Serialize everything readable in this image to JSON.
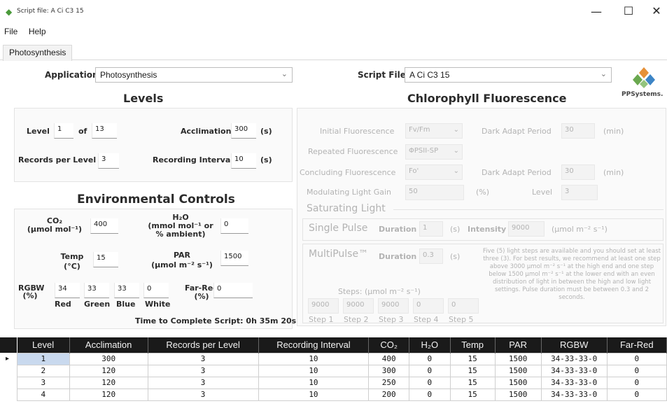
{
  "window": {
    "title": "Script file: A Ci C3 15",
    "minimize": "—",
    "maximize": "☐",
    "close": "✕"
  },
  "menu": {
    "file": "File",
    "help": "Help"
  },
  "tabs": {
    "active": "Photosynthesis"
  },
  "application": {
    "label": "Application",
    "value": "Photosynthesis"
  },
  "script_file": {
    "label": "Script File",
    "value": "A Ci C3 15"
  },
  "brand": {
    "logo_text": "PPSystems."
  },
  "levels": {
    "title": "Levels",
    "level_label": "Level",
    "level_value": "1",
    "of_label": "of",
    "of_value": "13",
    "acclimation_label": "Acclimation",
    "acclimation_value": "300",
    "acclimation_unit": "(s)",
    "records_label": "Records per Level",
    "records_value": "3",
    "interval_label": "Recording Interval",
    "interval_value": "10",
    "interval_unit": "(s)"
  },
  "chlorophyll": {
    "title": "Chlorophyll Fluorescence",
    "initial_label": "Initial Fluorescence",
    "initial_value": "Fv/Fm",
    "dark_adapt_label": "Dark Adapt Period",
    "dark_adapt_value_1": "30",
    "dark_adapt_unit": "(min)",
    "repeated_label": "Repeated Fluorescence",
    "repeated_value": "ΦPSII-SP",
    "concluding_label": "Concluding Fluorescence",
    "concluding_value": "Fo'",
    "dark_adapt_value_2": "30",
    "mod_gain_label": "Modulating Light Gain",
    "mod_gain_value": "50",
    "mod_gain_unit": "(%)",
    "level_label": "Level",
    "level_value": "3",
    "saturating_title": "Saturating Light",
    "single_pulse": "Single Pulse",
    "duration_label": "Duration",
    "single_duration": "1",
    "sec_unit": "(s)",
    "intensity_label": "Intensity",
    "intensity_value": "9000",
    "intensity_unit": "(µmol m⁻² s⁻¹)",
    "multipulse": "MultiPulse™",
    "multi_duration": "0.3",
    "multi_note": "Five (5) light steps are available and you should set at least three (3). For best results, we recommend at least one step above 3000 µmol m⁻² s⁻¹ at the high end and one step below 1500 µmol m⁻² s⁻¹ at the lower end with an even distribution of light in between the high and low light settings. Pulse duration must be between 0.3 and 2 seconds.",
    "steps_label": "Steps: (µmol m⁻² s⁻¹)",
    "step_values": [
      "9000",
      "9000",
      "9000",
      "0",
      "0"
    ],
    "step_names": [
      "Step 1",
      "Step 2",
      "Step 3",
      "Step 4",
      "Step 5"
    ]
  },
  "env": {
    "title": "Environmental Controls",
    "co2_label_1": "CO₂",
    "co2_label_2": "(µmol mol⁻¹)",
    "co2_value": "400",
    "h2o_label_1": "H₂O",
    "h2o_label_2": "(mmol mol⁻¹ or",
    "h2o_label_3": "% ambient)",
    "h2o_value": "0",
    "temp_label_1": "Temp",
    "temp_label_2": "(°C)",
    "temp_value": "15",
    "par_label_1": "PAR",
    "par_label_2": "(µmol m⁻² s⁻¹)",
    "par_value": "1500",
    "rgbw_label_1": "RGBW",
    "rgbw_label_2": "(%)",
    "red_value": "34",
    "green_value": "33",
    "blue_value": "33",
    "white_value": "0",
    "red_label": "Red",
    "green_label": "Green",
    "blue_label": "Blue",
    "white_label": "White",
    "farred_label_1": "Far-Red",
    "farred_label_2": "(%)",
    "farred_value": "0",
    "time_label": "Time to Complete Script: 0h 35m 20s"
  },
  "grid": {
    "headers": [
      "Level",
      "Acclimation",
      "Records per Level",
      "Recording Interval",
      "CO₂",
      "H₂O",
      "Temp",
      "PAR",
      "RGBW",
      "Far-Red"
    ],
    "rows": [
      [
        "1",
        "300",
        "3",
        "10",
        "400",
        "0",
        "15",
        "1500",
        "34-33-33-0",
        "0"
      ],
      [
        "2",
        "120",
        "3",
        "10",
        "300",
        "0",
        "15",
        "1500",
        "34-33-33-0",
        "0"
      ],
      [
        "3",
        "120",
        "3",
        "10",
        "250",
        "0",
        "15",
        "1500",
        "34-33-33-0",
        "0"
      ],
      [
        "4",
        "120",
        "3",
        "10",
        "200",
        "0",
        "15",
        "1500",
        "34-33-33-0",
        "0"
      ]
    ],
    "row_marker": "▸"
  },
  "colors": {
    "accent_selected_cell": "#c9d9ee",
    "header_bg": "#1a1a1a",
    "logo_green": "#6aa84f",
    "logo_orange": "#e69138"
  }
}
